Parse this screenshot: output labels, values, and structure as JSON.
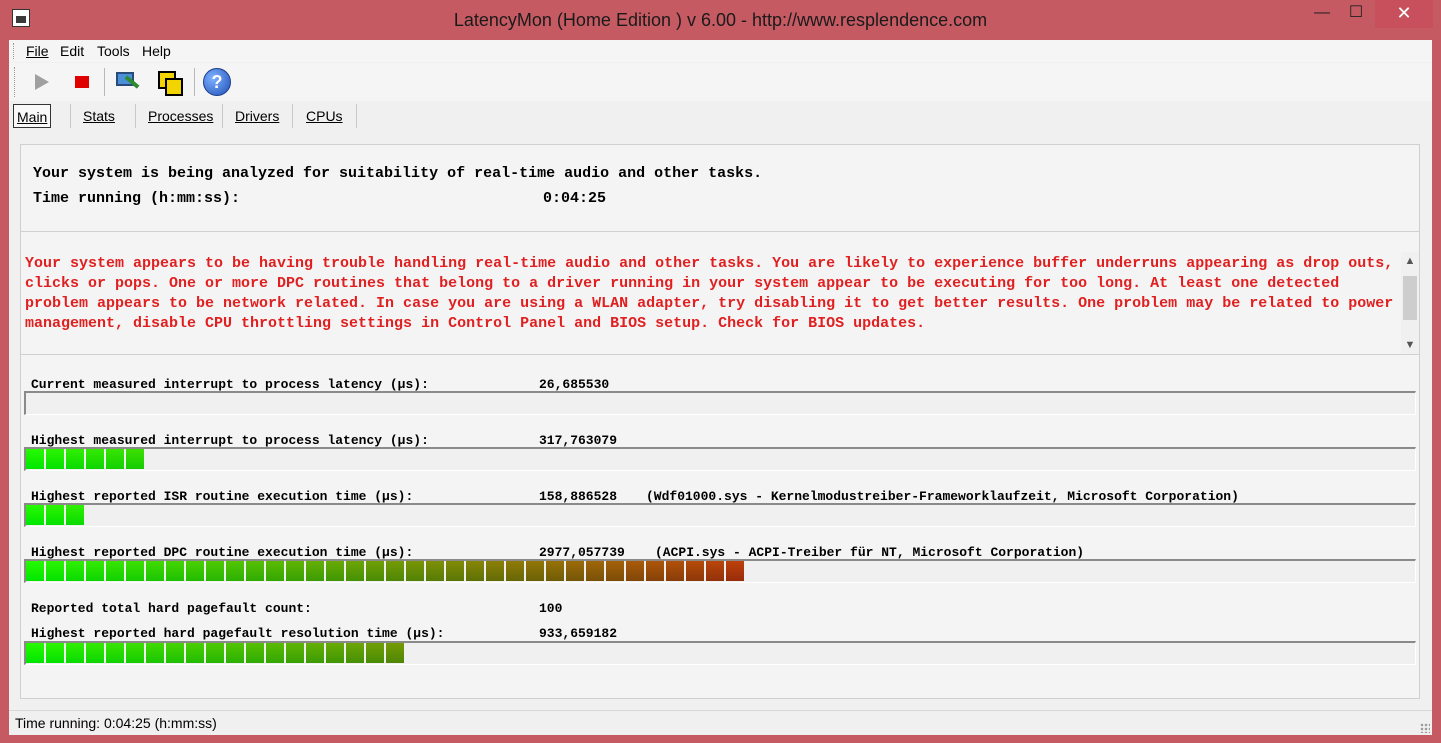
{
  "window": {
    "title": "LatencyMon  (Home Edition )  v 6.00 - http://www.resplendence.com",
    "minimize": "—",
    "maximize": "☐",
    "close": "✕"
  },
  "menu": [
    "File",
    "Edit",
    "Tools",
    "Help"
  ],
  "toolbar": {
    "icons": [
      "play-icon",
      "stop-icon",
      "monitor-wand-icon",
      "windows-icon",
      "help-icon"
    ],
    "help_glyph": "?"
  },
  "tabs": [
    "Main",
    "Stats",
    "Processes",
    "Drivers",
    "CPUs"
  ],
  "main": {
    "analyzing_text": "Your system is being analyzed for suitability of real-time audio and other tasks.",
    "time_running_label": "Time running (h:mm:ss):",
    "time_running_value": "0:04:25",
    "warning_text": "Your system appears to be having trouble handling real-time audio and other tasks. You are likely to experience buffer underruns appearing as drop outs, clicks or pops. One or more DPC routines that belong to a driver running in your system appear to be executing for too long. At least one detected problem appears to be network related. In case you are using a WLAN adapter, try disabling it to get better results. One problem may be related to power management, disable CPU throttling settings in Control Panel and BIOS setup. Check for BIOS updates.",
    "warning_color": "#e02020",
    "metrics": {
      "current_latency": {
        "label": "Current measured interrupt to process latency (µs):",
        "value": "26,685530",
        "segments": 0
      },
      "highest_latency": {
        "label": "Highest measured interrupt to process latency (µs):",
        "value": "317,763079",
        "segments": 6
      },
      "isr": {
        "label": "Highest reported ISR routine execution time (µs):",
        "value": "158,886528",
        "extra": "(Wdf01000.sys - Kernelmodustreiber-Frameworklaufzeit, Microsoft Corporation)",
        "segments": 3
      },
      "dpc": {
        "label": "Highest reported DPC routine execution time (µs):",
        "value": "2977,057739",
        "extra": "(ACPI.sys - ACPI-Treiber für NT, Microsoft Corporation)",
        "segments": 36
      },
      "pagefault_count": {
        "label": "Reported total hard pagefault count:",
        "value": "100"
      },
      "pagefault_time": {
        "label": "Highest reported hard pagefault resolution time (µs):",
        "value": "933,659182",
        "segments": 19
      }
    }
  },
  "status": {
    "text": "Time running: 0:04:25  (h:mm:ss)"
  }
}
